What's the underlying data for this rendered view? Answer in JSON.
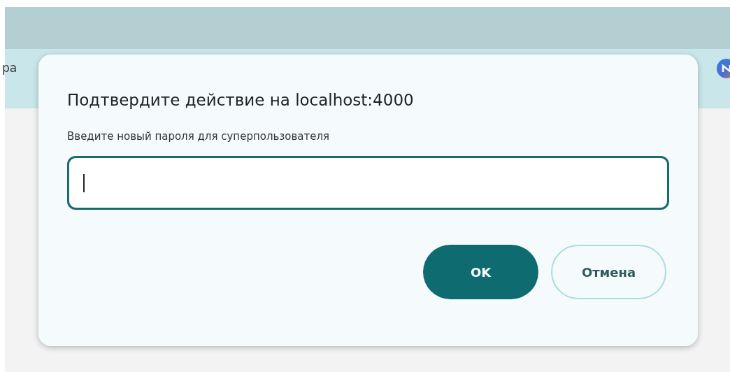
{
  "background": {
    "toolbar_text": "ра"
  },
  "dialog": {
    "title": "Подтвердите действие на localhost:4000",
    "message": "Введите новый пароля для суперпользователя",
    "input": {
      "focused": true
    },
    "buttons": [
      {
        "label": "OK",
        "kind": "primary"
      },
      {
        "label": "Отмена",
        "kind": "secondary"
      }
    ]
  }
}
